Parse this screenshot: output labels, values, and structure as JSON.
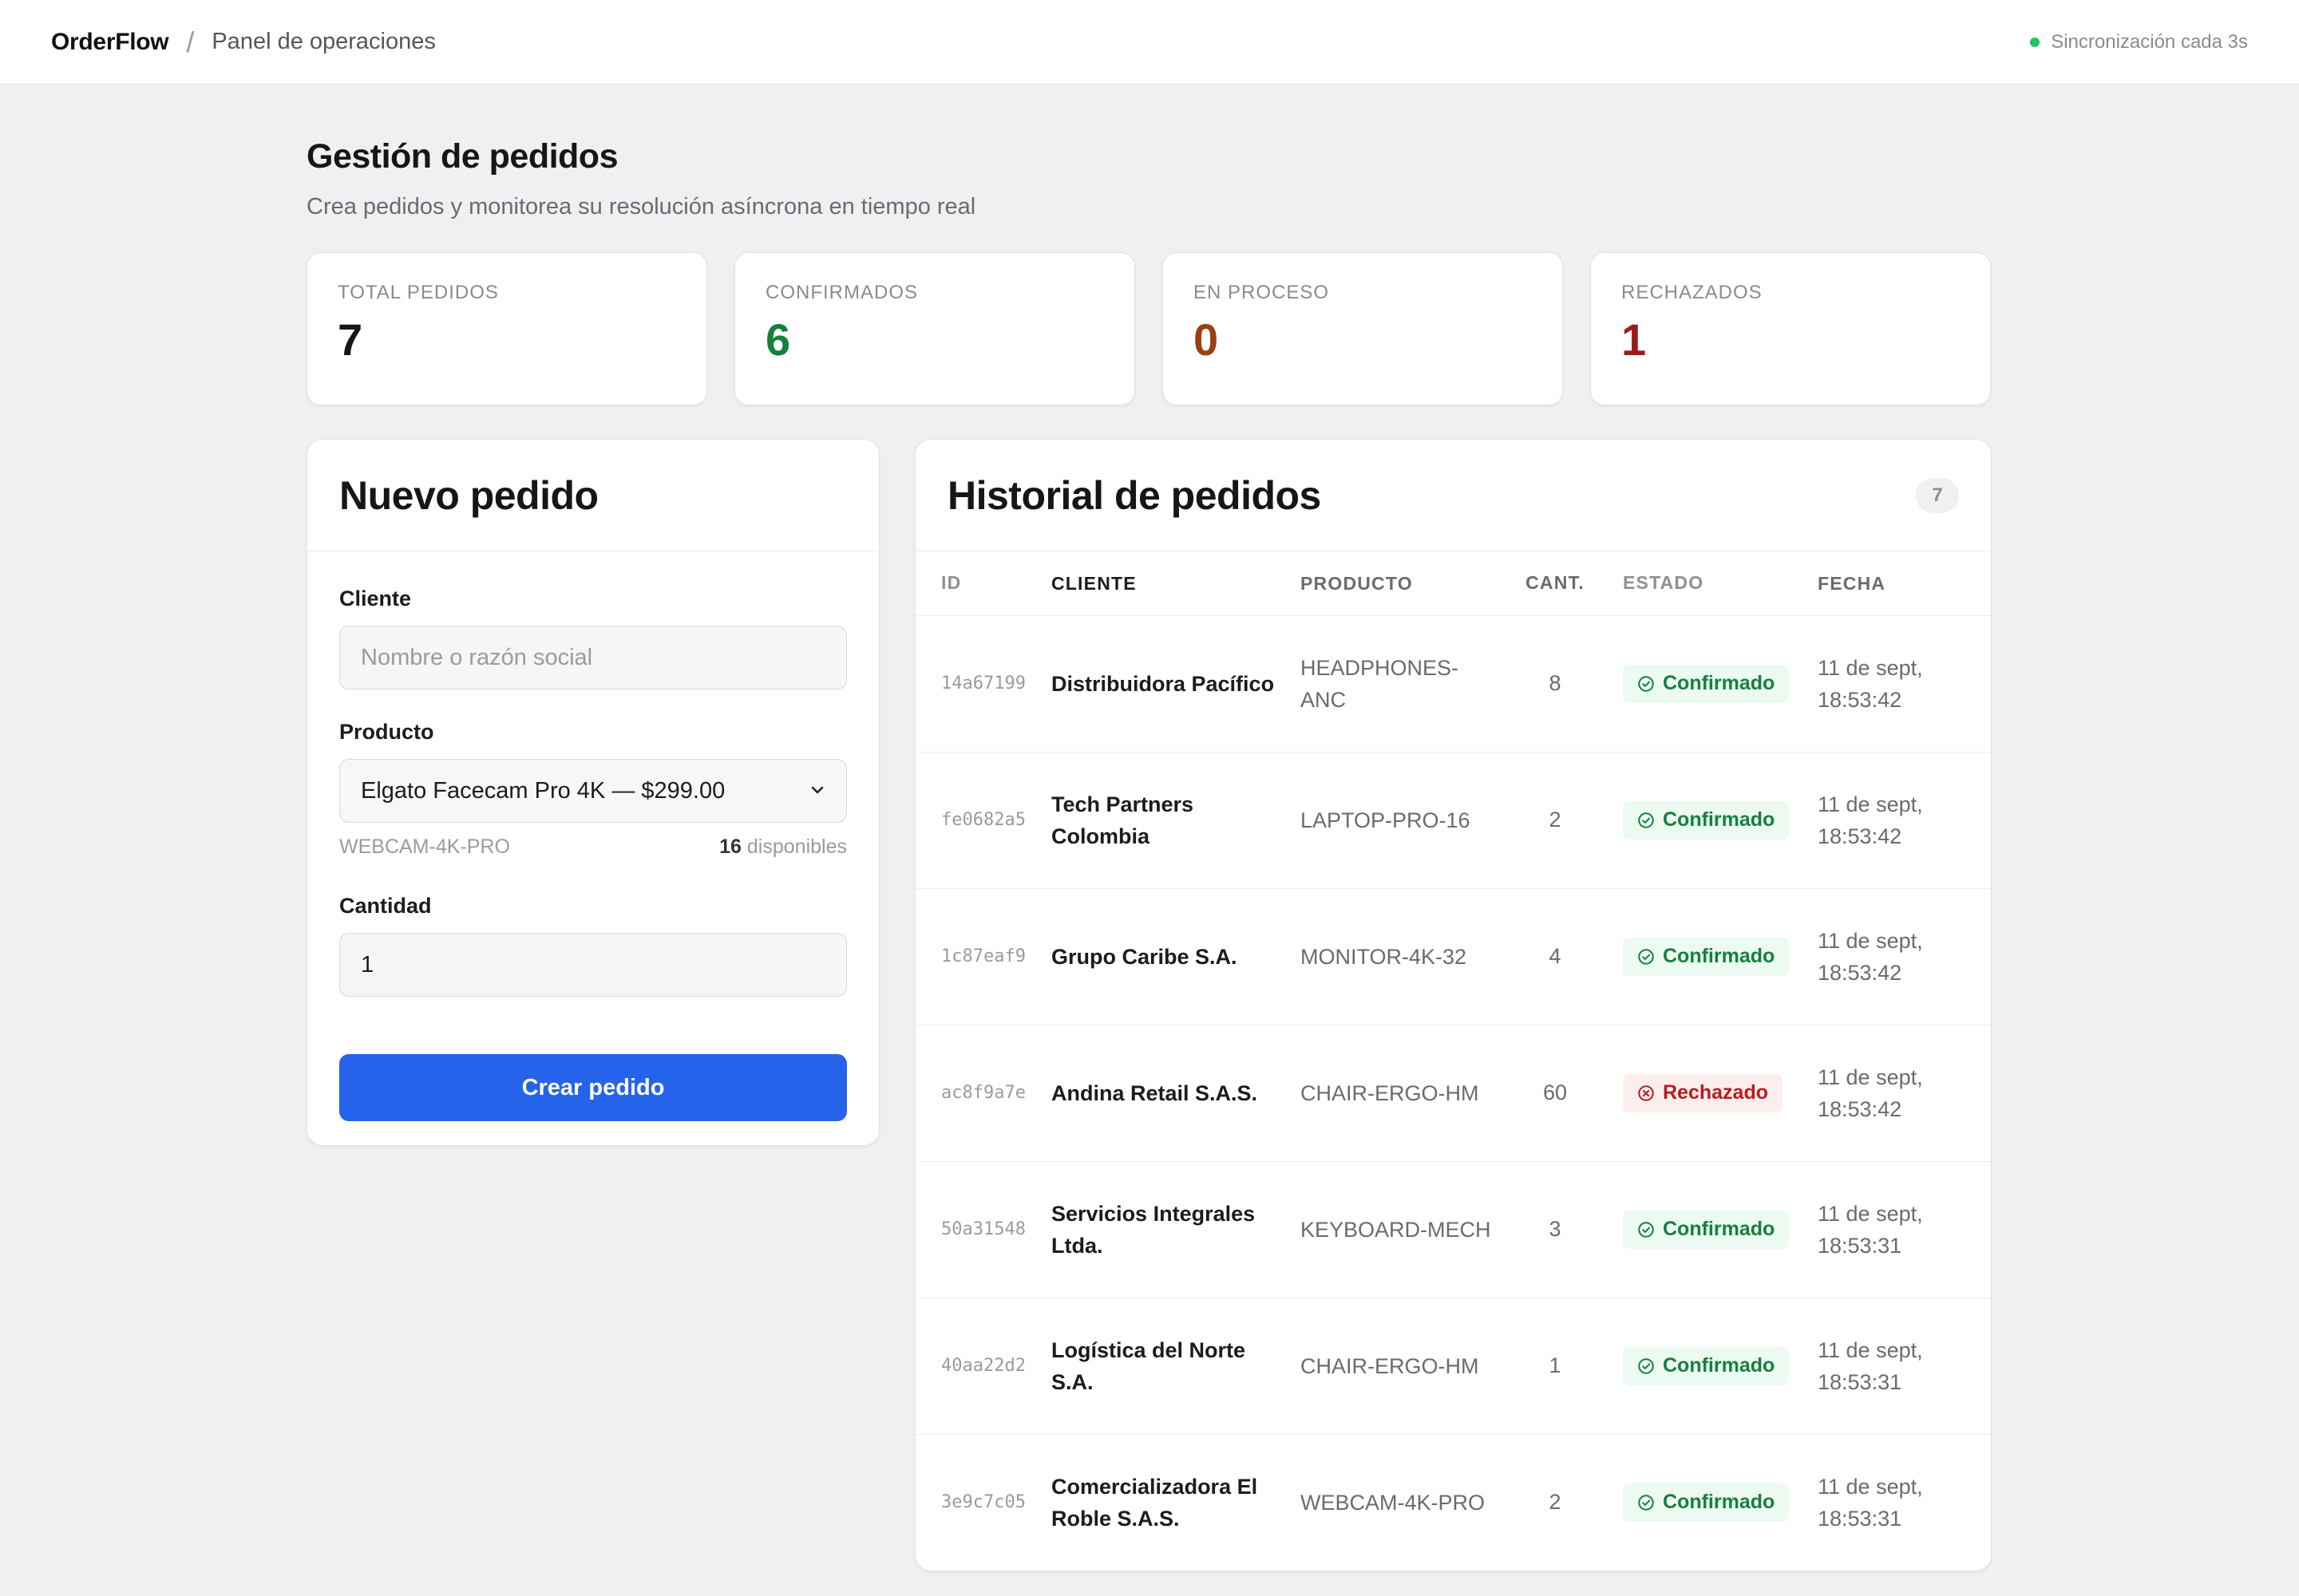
{
  "header": {
    "brand": "OrderFlow",
    "separator": "/",
    "section": "Panel de operaciones",
    "sync_status": "Sincronización cada 3s",
    "sync_color": "#22c55e"
  },
  "page": {
    "title": "Gestión de pedidos",
    "subtitle": "Crea pedidos y monitorea su resolución asíncrona en tiempo real"
  },
  "stats": [
    {
      "label": "TOTAL PEDIDOS",
      "value": "7",
      "color": "#161616"
    },
    {
      "label": "CONFIRMADOS",
      "value": "6",
      "color": "#15803d"
    },
    {
      "label": "EN PROCESO",
      "value": "0",
      "color": "#9a3f12"
    },
    {
      "label": "RECHAZADOS",
      "value": "1",
      "color": "#991b1b"
    }
  ],
  "form": {
    "title": "Nuevo pedido",
    "client_label": "Cliente",
    "client_placeholder": "Nombre o razón social",
    "product_label": "Producto",
    "product_selected": "Elgato Facecam Pro 4K — $299.00",
    "product_sku": "WEBCAM-4K-PRO",
    "stock_count": "16",
    "stock_suffix": "disponibles",
    "quantity_label": "Cantidad",
    "quantity_value": "1",
    "submit_label": "Crear pedido",
    "accent_color": "#2563eb"
  },
  "history": {
    "title": "Historial de pedidos",
    "count": "7",
    "columns": {
      "id": "ID",
      "client": "CLIENTE",
      "product": "PRODUCTO",
      "qty": "CANT.",
      "status": "ESTADO",
      "date": "FECHA"
    },
    "rows": [
      {
        "id": "14a67199",
        "client": "Distribuidora Pacífico",
        "product": "HEADPHONES-ANC",
        "qty": "8",
        "status": "Confirmado",
        "status_type": "ok",
        "date": "11 de sept, 18:53:42"
      },
      {
        "id": "fe0682a5",
        "client": "Tech Partners Colombia",
        "product": "LAPTOP-PRO-16",
        "qty": "2",
        "status": "Confirmado",
        "status_type": "ok",
        "date": "11 de sept, 18:53:42"
      },
      {
        "id": "1c87eaf9",
        "client": "Grupo Caribe S.A.",
        "product": "MONITOR-4K-32",
        "qty": "4",
        "status": "Confirmado",
        "status_type": "ok",
        "date": "11 de sept, 18:53:42"
      },
      {
        "id": "ac8f9a7e",
        "client": "Andina Retail S.A.S.",
        "product": "CHAIR-ERGO-HM",
        "qty": "60",
        "status": "Rechazado",
        "status_type": "bad",
        "date": "11 de sept, 18:53:42"
      },
      {
        "id": "50a31548",
        "client": "Servicios Integrales Ltda.",
        "product": "KEYBOARD-MECH",
        "qty": "3",
        "status": "Confirmado",
        "status_type": "ok",
        "date": "11 de sept, 18:53:31"
      },
      {
        "id": "40aa22d2",
        "client": "Logística del Norte S.A.",
        "product": "CHAIR-ERGO-HM",
        "qty": "1",
        "status": "Confirmado",
        "status_type": "ok",
        "date": "11 de sept, 18:53:31"
      },
      {
        "id": "3e9c7c05",
        "client": "Comercializadora El Roble S.A.S.",
        "product": "WEBCAM-4K-PRO",
        "qty": "2",
        "status": "Confirmado",
        "status_type": "ok",
        "date": "11 de sept, 18:53:31"
      }
    ]
  }
}
